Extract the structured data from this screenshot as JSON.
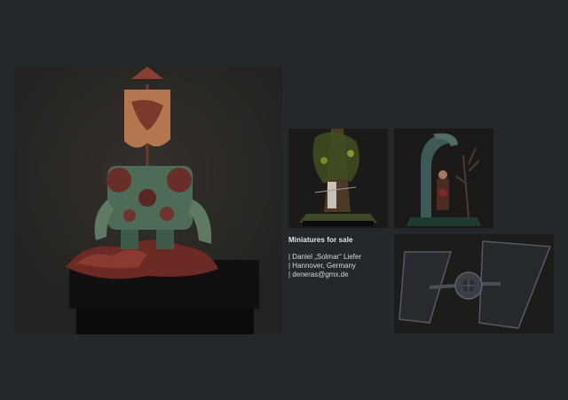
{
  "gallery": {
    "main_alt": "Miniature display piece",
    "thumbs": [
      "tree-diorama",
      "arch-figure",
      "starfighter"
    ]
  },
  "info": {
    "title": "Miniatures for sale",
    "lines": [
      "| Daniel „Solmar“ Liefer",
      "| Hannover, Germany",
      "| deneras@gmx.de"
    ]
  },
  "colors": {
    "background": "#23282b",
    "text": "#e8e8e8"
  }
}
